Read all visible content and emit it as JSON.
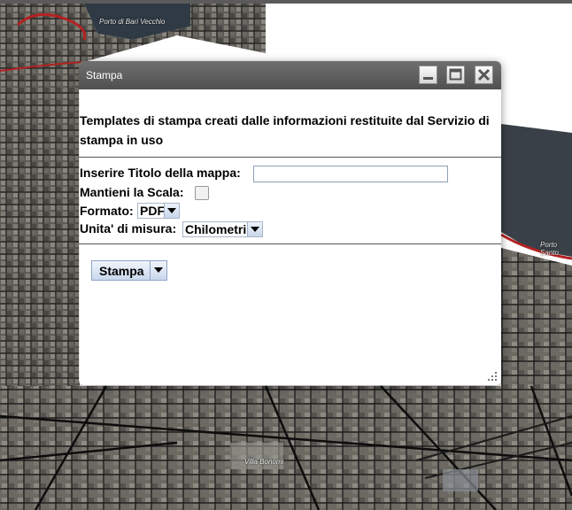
{
  "map": {
    "labels": [
      "Porto di Bari Vecchio",
      "Porto Santo",
      "Villa Bonomi"
    ]
  },
  "dialog": {
    "title": "Stampa",
    "window_buttons": [
      "minimize-icon",
      "maximize-icon",
      "close-icon"
    ],
    "description": "Templates di stampa creati dalle informazioni restituite dal Servizio di stampa in uso",
    "fields": {
      "title_label": "Inserire Titolo della mappa:",
      "title_value": "",
      "scale_label": "Mantieni la Scala:",
      "scale_checked": false,
      "format_label": "Formato:",
      "format_value": "PDF",
      "units_label": "Unita' di misura:",
      "units_value": "Chilometri"
    },
    "print_button": "Stampa"
  },
  "colors": {
    "titlebar": "#5a5a5a",
    "button_gradient_top": "#f1f5fb",
    "button_gradient_bottom": "#c9d7ec"
  }
}
